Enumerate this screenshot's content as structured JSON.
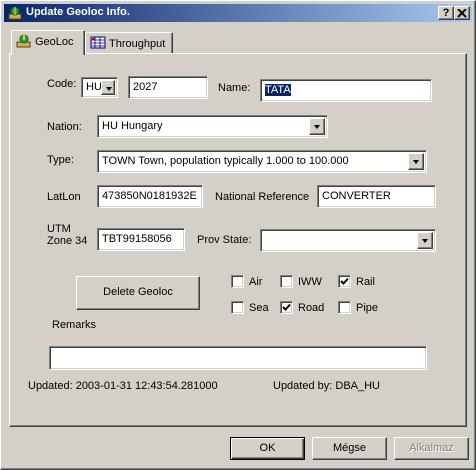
{
  "window": {
    "title": "Update Geoloc Info.",
    "help_label": "?",
    "close_label": "X"
  },
  "tabs": [
    {
      "label": "GeoLoc",
      "icon": "globe-pin-icon",
      "active": true
    },
    {
      "label": "Throughput",
      "icon": "chart-table-icon",
      "active": false
    }
  ],
  "form": {
    "code_label": "Code:",
    "code_country": "HU",
    "code_value": "2027",
    "name_label": "Name:",
    "name_value": "TATA",
    "nation_label": "Nation:",
    "nation_value": "HU Hungary",
    "type_label": "Type:",
    "type_value": "TOWN Town, population typically 1.000 to 100.000",
    "latlon_label": "LatLon",
    "latlon_value": "473850N0181932E",
    "natref_label": "National Reference",
    "natref_value": "CONVERTER",
    "utm_label_1": "UTM",
    "utm_label_2": "Zone 34",
    "utm_value": "TBT99158056",
    "provstate_label": "Prov State:",
    "provstate_value": "",
    "delete_label": "Delete Geoloc",
    "remarks_label": "Remarks",
    "remarks_value": "",
    "updated_text": "Updated: 2003-01-31 12:43:54.281000",
    "updated_by_text": "Updated by: DBA_HU"
  },
  "transport": [
    {
      "label": "Air",
      "checked": false
    },
    {
      "label": "IWW",
      "checked": false
    },
    {
      "label": "Rail",
      "checked": true
    },
    {
      "label": "Sea",
      "checked": false
    },
    {
      "label": "Road",
      "checked": true
    },
    {
      "label": "Pipe",
      "checked": false
    }
  ],
  "footer": {
    "ok_label": "OK",
    "cancel_label": "Mégse",
    "apply_label": "Alkalmaz"
  },
  "colors": {
    "title_bar_start": "#0a246a",
    "title_bar_end": "#a6caf0",
    "face": "#d4d0c8",
    "selection": "#0a246a"
  }
}
